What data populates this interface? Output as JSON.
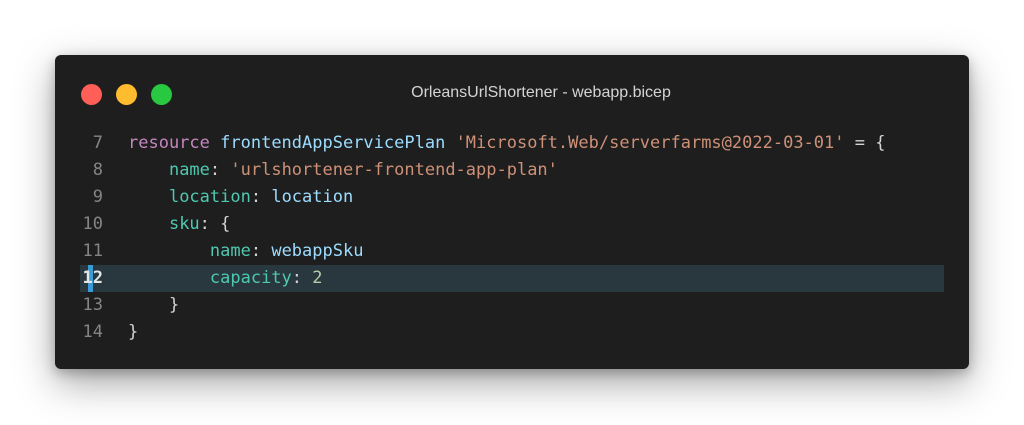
{
  "window": {
    "title": "OrleansUrlShortener - webapp.bicep",
    "controls": {
      "close": "close-icon",
      "minimize": "minimize-icon",
      "maximize": "maximize-icon"
    }
  },
  "editor": {
    "highlighted_line": "12",
    "lines": [
      {
        "number": "7",
        "indent": "",
        "tokens": [
          {
            "t": "resource",
            "c": "kw"
          },
          {
            "t": " ",
            "c": "pun"
          },
          {
            "t": "frontendAppServicePlan",
            "c": "id"
          },
          {
            "t": " ",
            "c": "pun"
          },
          {
            "t": "'Microsoft.Web/serverfarms@2022-03-01'",
            "c": "str"
          },
          {
            "t": " = {",
            "c": "pun"
          }
        ]
      },
      {
        "number": "8",
        "indent": "    ",
        "tokens": [
          {
            "t": "name",
            "c": "prop"
          },
          {
            "t": ": ",
            "c": "pun"
          },
          {
            "t": "'urlshortener-frontend-app-plan'",
            "c": "str"
          }
        ]
      },
      {
        "number": "9",
        "indent": "    ",
        "tokens": [
          {
            "t": "location",
            "c": "prop"
          },
          {
            "t": ": ",
            "c": "pun"
          },
          {
            "t": "location",
            "c": "id"
          }
        ]
      },
      {
        "number": "10",
        "indent": "    ",
        "tokens": [
          {
            "t": "sku",
            "c": "prop"
          },
          {
            "t": ": {",
            "c": "pun"
          }
        ]
      },
      {
        "number": "11",
        "indent": "        ",
        "tokens": [
          {
            "t": "name",
            "c": "prop"
          },
          {
            "t": ": ",
            "c": "pun"
          },
          {
            "t": "webappSku",
            "c": "id"
          }
        ]
      },
      {
        "number": "12",
        "indent": "        ",
        "tokens": [
          {
            "t": "capacity",
            "c": "prop"
          },
          {
            "t": ": ",
            "c": "pun"
          },
          {
            "t": "2",
            "c": "num"
          }
        ]
      },
      {
        "number": "13",
        "indent": "    ",
        "tokens": [
          {
            "t": "}",
            "c": "pun"
          }
        ]
      },
      {
        "number": "14",
        "indent": "",
        "tokens": [
          {
            "t": "}",
            "c": "pun"
          }
        ]
      }
    ]
  },
  "colors": {
    "background": "#1e1e1e",
    "keyword": "#c586c0",
    "identifier": "#9cdcfe",
    "property": "#4ec9b0",
    "string": "#ce9178",
    "number": "#b5cea8",
    "highlight": "#29383f",
    "marker": "#3b9bd6"
  }
}
